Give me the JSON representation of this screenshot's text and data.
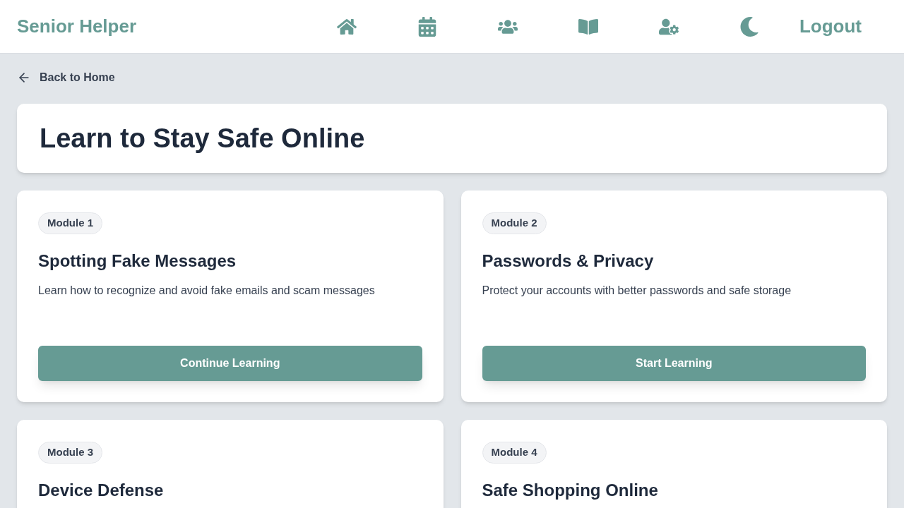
{
  "header": {
    "brand": "Senior Helper",
    "logout": "Logout"
  },
  "back_link": "Back to Home",
  "page_title": "Learn to Stay Safe Online",
  "modules": [
    {
      "badge": "Module 1",
      "title": "Spotting Fake Messages",
      "description": "Learn how to recognize and avoid fake emails and scam messages",
      "button": "Continue Learning"
    },
    {
      "badge": "Module 2",
      "title": "Passwords & Privacy",
      "description": "Protect your accounts with better passwords and safe storage",
      "button": "Start Learning"
    },
    {
      "badge": "Module 3",
      "title": "Device Defense"
    },
    {
      "badge": "Module 4",
      "title": "Safe Shopping Online"
    }
  ]
}
